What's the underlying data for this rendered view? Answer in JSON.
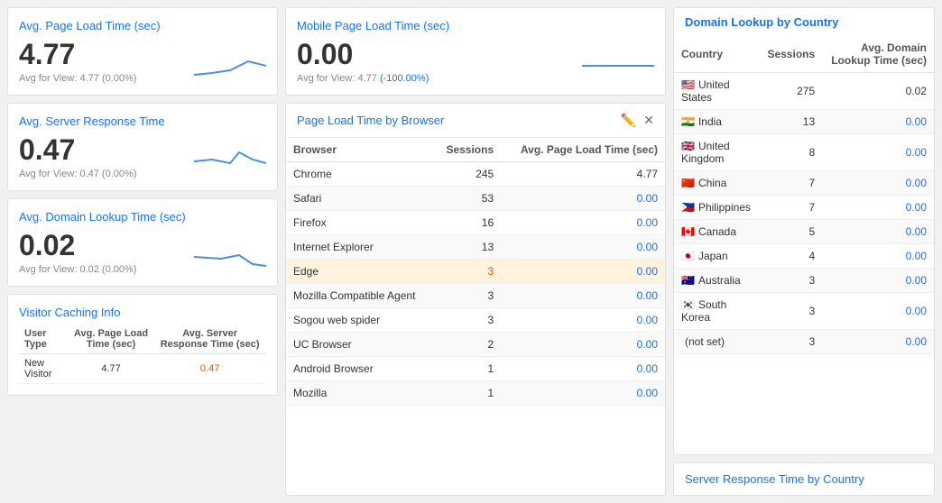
{
  "left": {
    "avgPageLoad": {
      "title": "Avg. Page Load Time (sec)",
      "value": "4.77",
      "avg": "Avg for View: 4.77 (0.00%)"
    },
    "avgServerResponse": {
      "title": "Avg. Server Response Time",
      "value": "0.47",
      "avg": "Avg for View: 0.47 (0.00%)"
    },
    "avgDomainLookup": {
      "title": "Avg. Domain Lookup Time (sec)",
      "value": "0.02",
      "avg": "Avg for View: 0.02 (0.00%)"
    },
    "visitorCaching": {
      "title": "Visitor Caching Info",
      "headers": [
        "User Type",
        "Avg. Page Load Time (sec)",
        "Avg. Server Response Time (sec)"
      ],
      "rows": [
        {
          "type": "New Visitor",
          "pageLoad": "4.77",
          "serverResponse": "0.47"
        }
      ]
    }
  },
  "middle": {
    "mobilePageLoad": {
      "title": "Mobile Page Load Time (sec)",
      "value": "0.00",
      "avg": "Avg for View: 4.77 (-100.00%)"
    },
    "browserTable": {
      "title": "Page Load Time by Browser",
      "headers": [
        "Browser",
        "Sessions",
        "Avg. Page Load Time (sec)"
      ],
      "rows": [
        {
          "browser": "Chrome",
          "sessions": "245",
          "avgLoad": "4.77"
        },
        {
          "browser": "Safari",
          "sessions": "53",
          "avgLoad": "0.00"
        },
        {
          "browser": "Firefox",
          "sessions": "16",
          "avgLoad": "0.00"
        },
        {
          "browser": "Internet Explorer",
          "sessions": "13",
          "avgLoad": "0.00"
        },
        {
          "browser": "Edge",
          "sessions": "3",
          "avgLoad": "0.00",
          "highlight": true
        },
        {
          "browser": "Mozilla Compatible Agent",
          "sessions": "3",
          "avgLoad": "0.00"
        },
        {
          "browser": "Sogou web spider",
          "sessions": "3",
          "avgLoad": "0.00"
        },
        {
          "browser": "UC Browser",
          "sessions": "2",
          "avgLoad": "0.00"
        },
        {
          "browser": "Android Browser",
          "sessions": "1",
          "avgLoad": "0.00"
        },
        {
          "browser": "Mozilla",
          "sessions": "1",
          "avgLoad": "0.00"
        }
      ]
    }
  },
  "right": {
    "domainLookup": {
      "title": "Domain Lookup by Country",
      "headers": [
        "Country",
        "Sessions",
        "Avg. Domain Lookup Time (sec)"
      ],
      "rows": [
        {
          "flag": "🇺🇸",
          "country": "United States",
          "sessions": "275",
          "avgLookup": "0.02"
        },
        {
          "flag": "🇮🇳",
          "country": "India",
          "sessions": "13",
          "avgLookup": "0.00"
        },
        {
          "flag": "🇬🇧",
          "country": "United Kingdom",
          "sessions": "8",
          "avgLookup": "0.00"
        },
        {
          "flag": "🇨🇳",
          "country": "China",
          "sessions": "7",
          "avgLookup": "0.00"
        },
        {
          "flag": "🇵🇭",
          "country": "Philippines",
          "sessions": "7",
          "avgLookup": "0.00"
        },
        {
          "flag": "🇨🇦",
          "country": "Canada",
          "sessions": "5",
          "avgLookup": "0.00"
        },
        {
          "flag": "🇯🇵",
          "country": "Japan",
          "sessions": "4",
          "avgLookup": "0.00"
        },
        {
          "flag": "🇦🇺",
          "country": "Australia",
          "sessions": "3",
          "avgLookup": "0.00"
        },
        {
          "flag": "🇰🇷",
          "country": "South Korea",
          "sessions": "3",
          "avgLookup": "0.00"
        },
        {
          "flag": "",
          "country": "(not set)",
          "sessions": "3",
          "avgLookup": "0.00"
        }
      ]
    },
    "serverResponseFooter": {
      "title": "Server Response Time by Country"
    }
  }
}
